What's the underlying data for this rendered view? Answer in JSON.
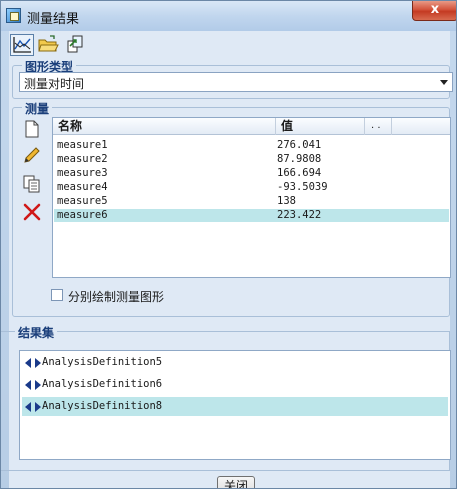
{
  "window": {
    "title": "测量结果",
    "close_glyph": "x"
  },
  "toolbar": {
    "buttons": [
      {
        "icon": "chart-icon"
      },
      {
        "icon": "open-folder-icon"
      },
      {
        "icon": "export-icon"
      }
    ]
  },
  "graph_type": {
    "title": "图形类型",
    "selected": "测量对时间"
  },
  "measure": {
    "title": "测量",
    "tools": [
      {
        "icon": "new-document-icon"
      },
      {
        "icon": "pencil-icon"
      },
      {
        "icon": "copy-icon"
      },
      {
        "icon": "delete-icon"
      }
    ],
    "columns": {
      "name": "名称",
      "value": "值",
      "extra": ". ."
    },
    "rows": [
      {
        "name": "measure1",
        "value": "276.041"
      },
      {
        "name": "measure2",
        "value": "87.9808"
      },
      {
        "name": "measure3",
        "value": "166.694"
      },
      {
        "name": "measure4",
        "value": "-93.5039"
      },
      {
        "name": "measure5",
        "value": "138"
      },
      {
        "name": "measure6",
        "value": "223.422",
        "selected": true
      }
    ],
    "checkbox_label": "分别绘制测量图形"
  },
  "result_set": {
    "title": "结果集",
    "items": [
      {
        "label": "AnalysisDefinition5"
      },
      {
        "label": "AnalysisDefinition6"
      },
      {
        "label": "AnalysisDefinition8",
        "selected": true
      }
    ]
  },
  "footer": {
    "close_label": "关闭"
  }
}
